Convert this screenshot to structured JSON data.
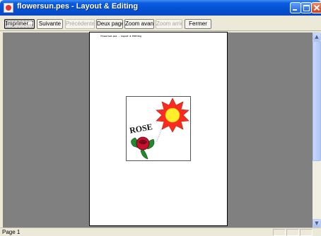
{
  "window": {
    "title": "flowersun.pes - Layout & Editing",
    "app_icon": "layout-editing-app-icon",
    "buttons": [
      "minimize-icon",
      "maximize-icon",
      "close-icon"
    ]
  },
  "toolbar": {
    "print_label": "Imprimer...",
    "next_label": "Suivante",
    "previous_label": "Précédente",
    "two_pages_label": "Deux pages",
    "zoom_in_label": "Zoom avant",
    "zoom_out_label": "Zoom arrière",
    "close_label": "Fermer"
  },
  "preview": {
    "header_text": "flowersun.pes - Layout & Editing",
    "motif_text": "ROSE"
  },
  "status": {
    "page_label": "Page 1"
  },
  "colors": {
    "titlebar": "#0451d2",
    "workspace": "#808080",
    "sun_ray": "#ff2a1e",
    "sun_core": "#ffef2a",
    "rose": "#c8102e",
    "leaf": "#1f8b2a"
  }
}
